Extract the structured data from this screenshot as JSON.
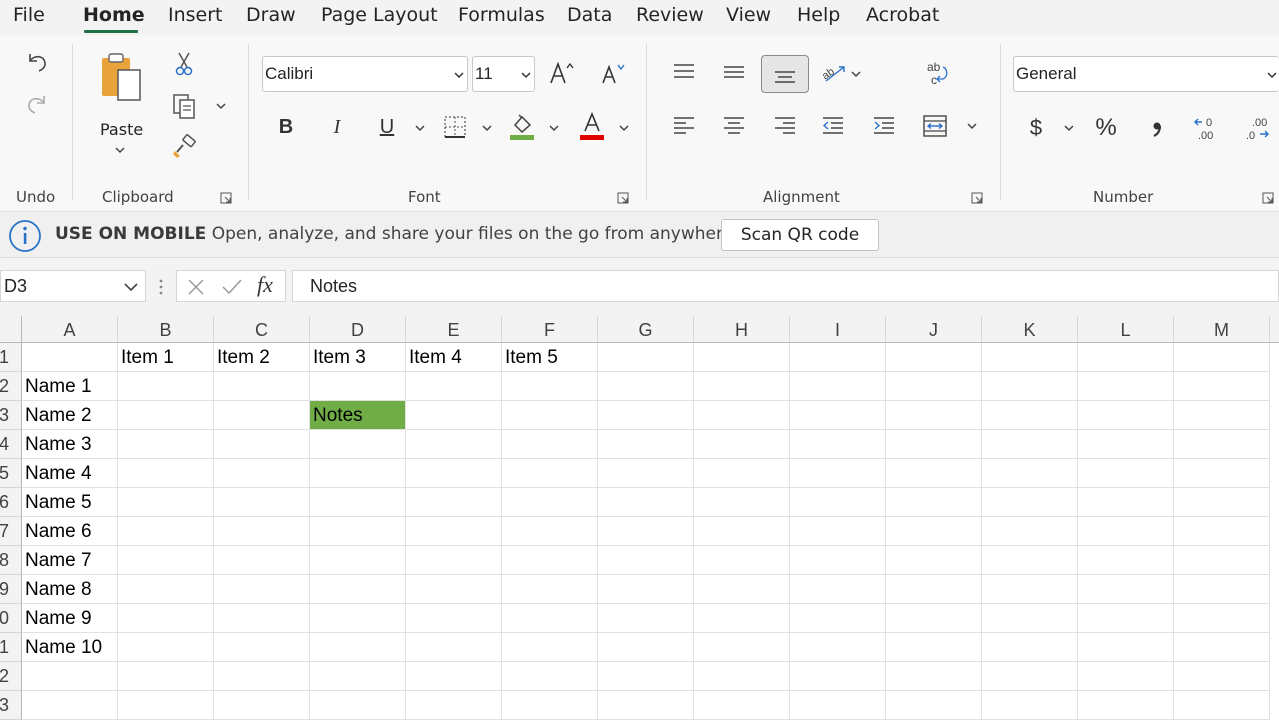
{
  "menu": {
    "tabs": [
      "File",
      "Home",
      "Insert",
      "Draw",
      "Page Layout",
      "Formulas",
      "Data",
      "Review",
      "View",
      "Help",
      "Acrobat"
    ],
    "active": "Home"
  },
  "ribbon": {
    "undo_group_label": "Undo",
    "clipboard": {
      "label": "Clipboard",
      "paste_label": "Paste"
    },
    "font": {
      "label": "Font",
      "family": "Calibri",
      "size": "11"
    },
    "alignment": {
      "label": "Alignment"
    },
    "number": {
      "label": "Number",
      "format": "General"
    },
    "colors": {
      "fill": "#70ad47",
      "font_color": "#e00000"
    }
  },
  "infobar": {
    "title": "USE ON MOBILE",
    "message": "Open, analyze, and share your files on the go from anywhere.",
    "button": "Scan QR code"
  },
  "formula_bar": {
    "name_box": "D3",
    "content": "Notes"
  },
  "sheet": {
    "columns": [
      "A",
      "B",
      "C",
      "D",
      "E",
      "F",
      "G",
      "H",
      "I",
      "J",
      "K",
      "L",
      "M"
    ],
    "row_labels": [
      "1",
      "2",
      "3",
      "4",
      "5",
      "6",
      "7",
      "8",
      "9",
      "0",
      "1",
      "2",
      "3"
    ],
    "cells": {
      "B1": "Item 1",
      "C1": "Item 2",
      "D1": "Item 3",
      "E1": "Item 4",
      "F1": "Item 5",
      "A2": "Name 1",
      "A3": "Name 2",
      "A4": "Name 3",
      "A5": "Name 4",
      "A6": "Name 5",
      "A7": "Name 6",
      "A8": "Name 7",
      "A9": "Name 8",
      "A10": "Name 9",
      "A11": "Name 10",
      "D3": "Notes"
    },
    "highlight_cell": "D3",
    "highlight_color": "#70ad47"
  }
}
